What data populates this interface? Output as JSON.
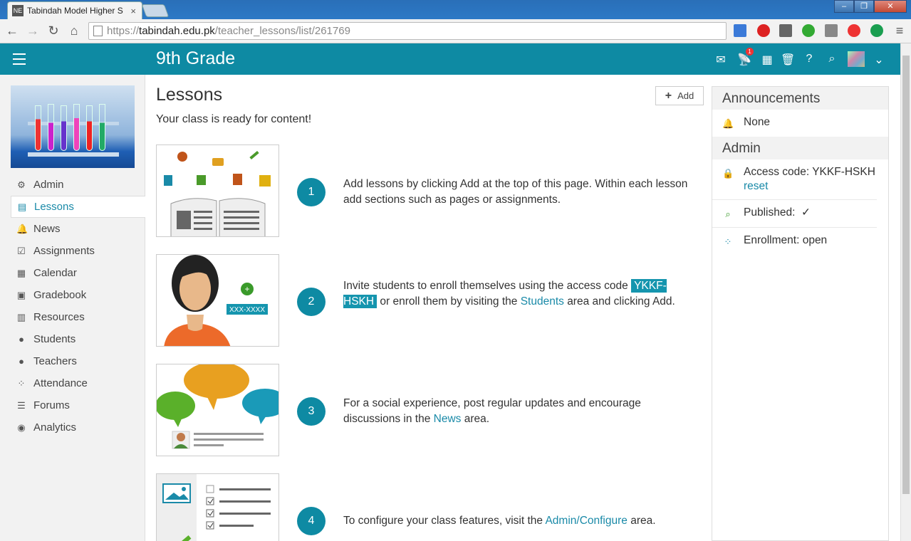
{
  "browser": {
    "tab_title": "Tabindah Model Higher S",
    "tab_favicon": "NE",
    "url_prefix": "https://",
    "url_main": "tabindah.edu.pk",
    "url_path": "/teacher_lessons/list/261769"
  },
  "header": {
    "title": "9th Grade",
    "notification_count": "1",
    "icons": [
      "mail-icon",
      "antenna-icon",
      "calendar-icon",
      "trash-icon",
      "help-icon",
      "search-icon",
      "avatar",
      "chevron-down-icon"
    ]
  },
  "sidebar": {
    "items": [
      {
        "label": "Admin",
        "icon": "gear-icon"
      },
      {
        "label": "Lessons",
        "icon": "lessons-icon",
        "active": true
      },
      {
        "label": "News",
        "icon": "bell-icon"
      },
      {
        "label": "Assignments",
        "icon": "checkbox-icon"
      },
      {
        "label": "Calendar",
        "icon": "calendar-icon"
      },
      {
        "label": "Gradebook",
        "icon": "gradebook-icon"
      },
      {
        "label": "Resources",
        "icon": "resources-icon"
      },
      {
        "label": "Students",
        "icon": "user-icon"
      },
      {
        "label": "Teachers",
        "icon": "teacher-icon"
      },
      {
        "label": "Attendance",
        "icon": "attendance-icon"
      },
      {
        "label": "Forums",
        "icon": "list-icon"
      },
      {
        "label": "Analytics",
        "icon": "globe-icon"
      }
    ]
  },
  "main": {
    "title": "Lessons",
    "subtitle": "Your class is ready for content!",
    "add_label": "Add",
    "steps": [
      {
        "num": "1",
        "text": "Add lessons by clicking Add at the top of this page. Within each lesson add sections such as pages or assignments."
      },
      {
        "num": "2",
        "text_a": "Invite students to enroll themselves using the access code",
        "code": "YKKF-HSKH",
        "text_b": "or enroll them by visiting the",
        "link": "Students",
        "text_c": "area and clicking Add.",
        "thumb_code": "XXX-XXXX"
      },
      {
        "num": "3",
        "text_a": "For a social experience, post regular updates and encourage discussions in the",
        "link": "News",
        "text_b": "area."
      },
      {
        "num": "4",
        "text_a": "To configure your class features, visit the",
        "link": "Admin/Configure",
        "text_b": "area."
      }
    ]
  },
  "panel": {
    "announcements_title": "Announcements",
    "announcements_value": "None",
    "admin_title": "Admin",
    "access_code_label": "Access code: YKKF-HSKH",
    "reset_label": "reset",
    "published_label": "Published:",
    "published_check": "✓",
    "enrollment_label": "Enrollment: open"
  },
  "colors": {
    "brand": "#0e8aa3",
    "link": "#1a8aa8",
    "sidebar_bg": "#f2f2f2"
  }
}
